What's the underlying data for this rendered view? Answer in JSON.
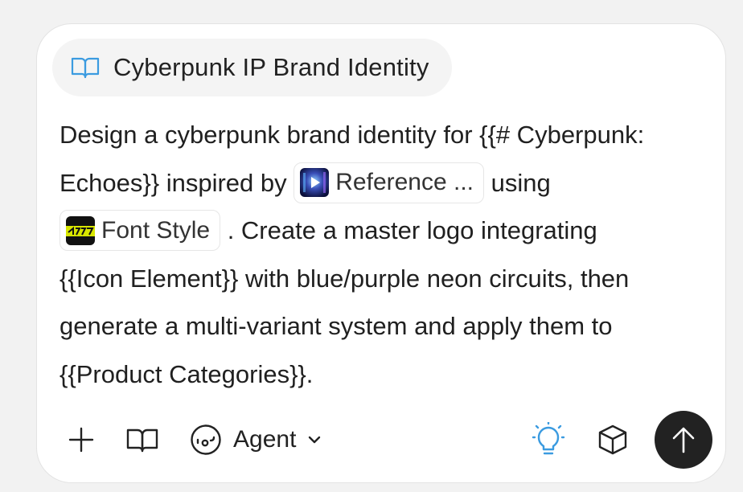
{
  "title_chip": {
    "icon": "book-open-icon",
    "label": "Cyberpunk IP Brand Identity"
  },
  "prompt": {
    "line1": "Design a cyberpunk brand identity for {{# Cyberpunk:",
    "line2_pre": "Echoes}} inspired by",
    "reference_chip": {
      "label": "Reference ...",
      "icon": "video-thumbnail"
    },
    "line2_post": "using",
    "font_chip": {
      "label": "Font Style",
      "icon": "font-thumbnail"
    },
    "line3_post": ". Create a master logo integrating",
    "line4": "{{Icon Element}} with blue/purple neon circuits, then",
    "line5": "generate a multi-variant system and apply them to",
    "line6": "{{Product Categories}}."
  },
  "toolbar": {
    "add_icon": "plus-icon",
    "book_icon": "book-open-icon",
    "agent_label": "Agent",
    "agent_icon": "agent-face-icon",
    "chevron_icon": "chevron-down-icon",
    "bulb_icon": "lightbulb-icon",
    "cube_icon": "cube-icon",
    "send_icon": "arrow-up-icon"
  },
  "colors": {
    "accent": "#3b9be0",
    "send_bg": "#222222",
    "background": "#f2f2f2"
  }
}
